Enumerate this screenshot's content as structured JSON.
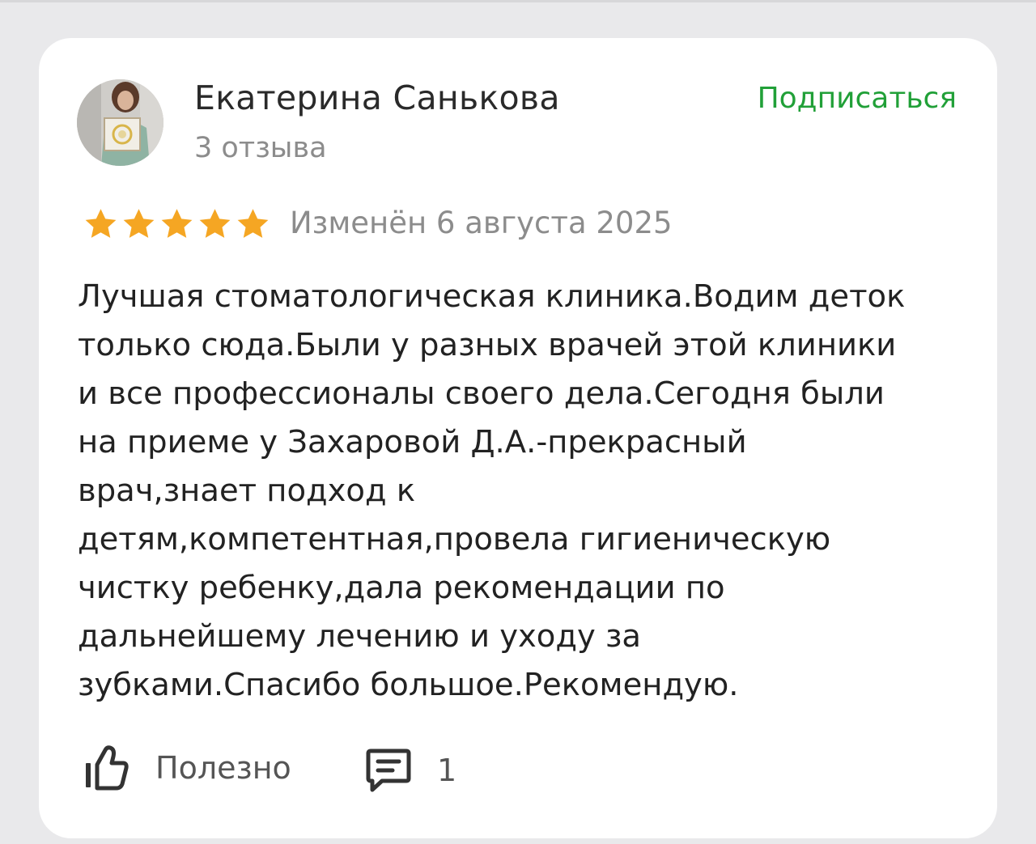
{
  "author": {
    "name": "Екатерина Санькова",
    "reviews_count": "3 отзыва",
    "subscribe_label": "Подписаться"
  },
  "rating": {
    "stars": 5,
    "max": 5,
    "date": "Изменён 6 августа 2025"
  },
  "review": {
    "text": "Лучшая стоматологическая клиника.Водим деток\nтолько сюда.Были у разных врачей этой клиники\nи все профессионалы своего дела.Сегодня были\nна приеме у Захаровой Д.А.-прекрасный\nврач,знает подход к\nдетям,компетентная,провела гигиеническую\nчистку ребенку,дала рекомендации по\nдальнейшему лечению и уходу за\nзубками.Спасибо большое.Рекомендую."
  },
  "actions": {
    "like_label": "Полезно",
    "comments_count": "1"
  },
  "colors": {
    "accent_green": "#21a038",
    "star_gold": "#f5a623",
    "muted_text": "#8c8c8c"
  },
  "icons": {
    "like": "thumbs-up-icon",
    "comment": "comment-icon",
    "star": "star-icon"
  }
}
